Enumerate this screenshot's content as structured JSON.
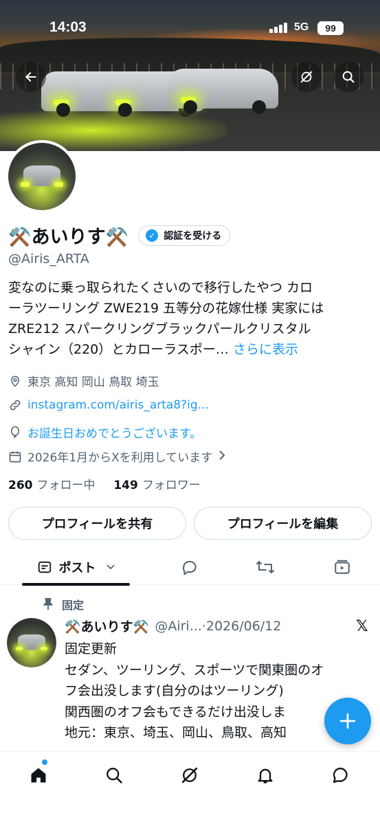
{
  "status_bar": {
    "time": "14:03",
    "network": "5G",
    "battery": "99"
  },
  "header": {
    "back_icon": "arrow-left-icon",
    "grok_icon": "grok-icon",
    "search_icon": "search-icon"
  },
  "profile": {
    "display_name": "⚒️あいりす⚒️",
    "verify_label": "認証を受ける",
    "handle": "@Airis_ARTA",
    "bio_lines": [
      "変なのに乗っ取られたくさいので移行したやつ カロ",
      "ーラツーリング ZWE219 五等分の花嫁仕様 実家には",
      " ZRE212 スパークリングブラックパールクリスタル",
      "シャイン（220）とカローラスポー… "
    ],
    "bio_more": "さらに表示",
    "location": "東京 高知 岡山 鳥取 埼玉",
    "link": "instagram.com/airis_arta8?ig...",
    "birthday": "お誕生日おめでとうございます。",
    "joined": "2026年1月からXを利用しています",
    "following_count": "260",
    "following_label": "フォロー中",
    "followers_count": "149",
    "followers_label": "フォロワー",
    "share_button": "プロフィールを共有",
    "edit_button": "プロフィールを編集"
  },
  "tabs": {
    "posts_label": "ポスト"
  },
  "post": {
    "pinned_label": "固定",
    "name": "⚒️あいりす⚒️",
    "handle_date": "@Airi...·2026/06/12",
    "lines": [
      "固定更新",
      "セダン、ツーリング、スポーツで関東圏のオ",
      "フ会出没します(自分のはツーリング)",
      "関西圏のオフ会もできるだけ出没しま",
      "地元：東京、埼玉、岡山、鳥取、高知"
    ],
    "x_mark": "𝕏"
  },
  "colors": {
    "accent": "#1d9bf0",
    "text": "#0f1419",
    "secondary": "#536471",
    "border": "#cfd9de"
  },
  "bottom_nav": [
    "home-icon",
    "search-icon",
    "grok-icon",
    "bell-icon",
    "chat-icon"
  ]
}
